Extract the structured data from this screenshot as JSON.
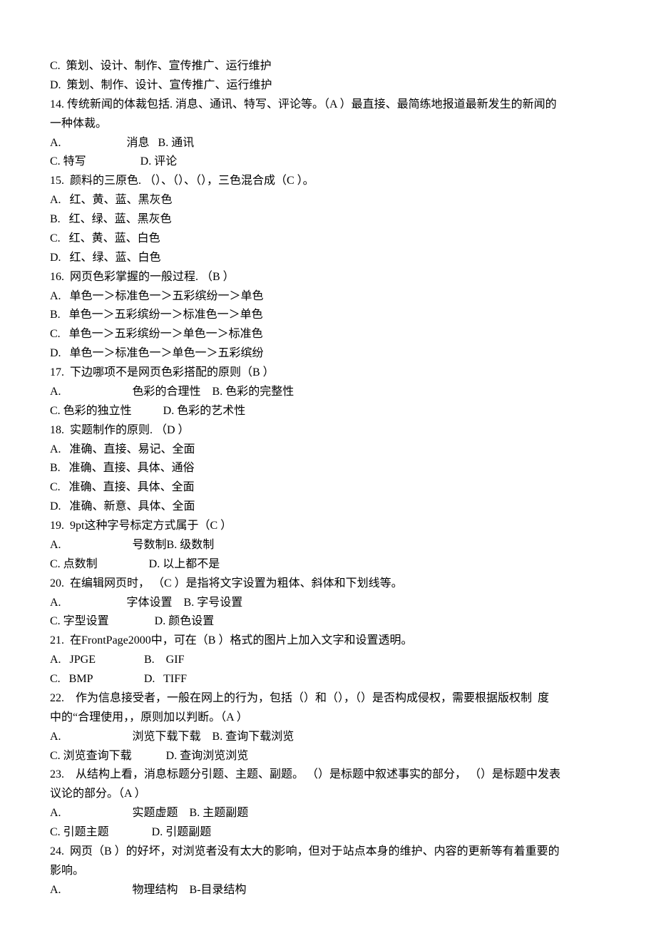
{
  "lines": [
    "C.  策划、设计、制作、宣传推广、运行维护",
    "D.  策划、制作、设计、宣传推广、运行维护",
    "14. 传统新闻的体裁包括. 消息、通讯、特写、评论等。（A ）最直接、最简练地报道最新发生的新闻的",
    "一种体裁。",
    "A.                       消息   B. 通讯",
    "C. 特写                   D. 评论",
    "15.  颜料的三原色. （）、（）、（），三色混合成（C ）。",
    "A.   红、黄、蓝、黑灰色",
    "B.   红、绿、蓝、黑灰色",
    "C.   红、黄、蓝、白色",
    "D.   红、绿、蓝、白色",
    "16.  网页色彩掌握的一般过程. （B ）",
    "A.   单色一＞标准色一＞五彩缤纷一＞单色",
    "B.   单色一＞五彩缤纷一＞标准色一＞单色",
    "C.   单色一＞五彩缤纷一＞单色一＞标准色",
    "D.   单色一＞标准色一＞单色一＞五彩缤纷",
    "17.  下边哪项不是网页色彩搭配的原则（B ）",
    "A.                         色彩的合理性    B. 色彩的完整性",
    "C. 色彩的独立性           D. 色彩的艺术性",
    "18.  实题制作的原则. （D ）",
    "A.   准确、直接、易记、全面",
    "B.   准确、直接、具体、通俗",
    "C.   准确、直接、具体、全面",
    "D.   准确、新意、具体、全面",
    "19.  9pt这种字号标定方式属于（C ）",
    "A.                         号数制B. 级数制",
    "C. 点数制                  D. 以上都不是",
    "20.  在编辑网页时， （C ）是指将文字设置为粗体、斜体和下划线等。",
    "A.                       字体设置    B. 字号设置",
    "C. 字型设置                D. 颜色设置",
    "21.  在FrontPage2000中，可在（B ）格式的图片上加入文字和设置透明。",
    "A.   JPGE                 B.    GIF",
    "C.   BMP                  D.   TIFF",
    "22.    作为信息接受者，一般在网上的行为，包括（）和（），（）是否构成侵权，需要根据版权制  度",
    "中的“合理使用，，原则加以判断。（A ）",
    "A.                         浏览下载下载    B. 查询下载浏览",
    "C. 浏览查询下载            D. 查询浏览浏览",
    "23.    从结构上看，消息标题分引题、主题、副题。 （）是标题中叙述事实的部分， （）是标题中发表",
    "议论的部分。（A ）",
    "A.                         实题虚题    B. 主题副题",
    "C. 引题主题               D. 引题副题",
    "24.  网页（B ）的好坏，对浏览者没有太大的影响，但对于站点本身的维护、内容的更新等有着重要的",
    "影响。",
    "A.                         物理结构    B-目录结构"
  ]
}
